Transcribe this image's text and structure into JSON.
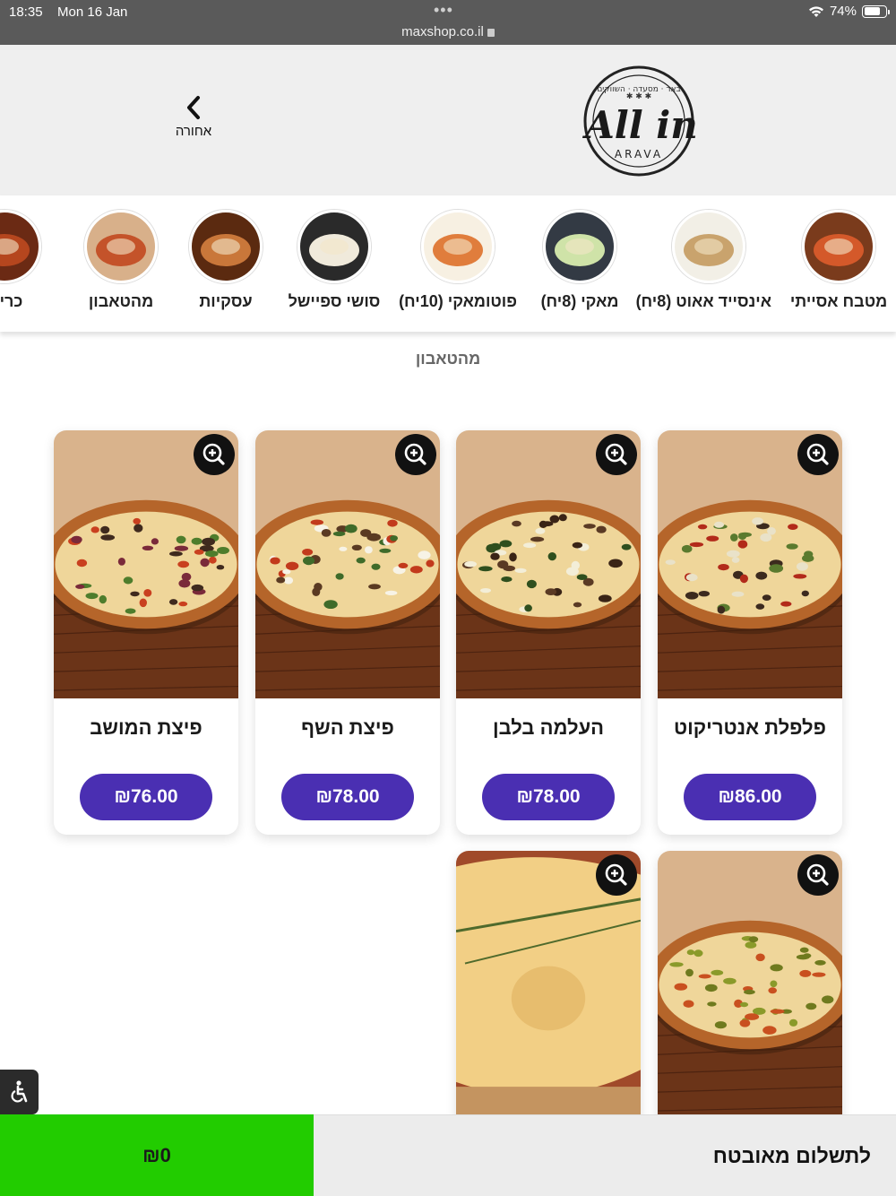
{
  "status_bar": {
    "time": "18:35",
    "date": "Mon 16 Jan",
    "url": "maxshop.co.il",
    "battery": "74%",
    "battery_level": 0.74
  },
  "header": {
    "back_label": "אחורה",
    "logo_text": "All in",
    "logo_sub": "ARAVA",
    "logo_ring": "באר · מסעדה · השווקים"
  },
  "categories": [
    {
      "label": "מטבח אסייתי",
      "icon": "asian-bowl"
    },
    {
      "label": "אינסייד אאוט (8יח)",
      "icon": "sushi-rolls"
    },
    {
      "label": "מאקי (8יח)",
      "icon": "maki-plate"
    },
    {
      "label": "פוטומאקי (10יח)",
      "icon": "futomaki-plate"
    },
    {
      "label": "סושי ספיישל",
      "icon": "sushi-special"
    },
    {
      "label": "עסקיות",
      "icon": "business-meal"
    },
    {
      "label": "מהטאבון",
      "icon": "pizza"
    },
    {
      "label": "כריכי",
      "icon": "sandwich"
    }
  ],
  "section": {
    "title": "מהטאבון"
  },
  "products": [
    {
      "name": "פלפלת אנטריקוט",
      "price": "₪86.00"
    },
    {
      "name": "העלמה בלבן",
      "price": "₪78.00"
    },
    {
      "name": "פיצת השף",
      "price": "₪78.00"
    },
    {
      "name": "פיצת המושב",
      "price": "₪76.00"
    },
    {
      "name": "",
      "price": ""
    },
    {
      "name": "",
      "price": ""
    }
  ],
  "footer": {
    "total": "₪0",
    "checkout_label": "לתשלום מאובטח"
  },
  "colors": {
    "price_button": "#4a2fb2",
    "total_bar": "#22cc00",
    "header_bg": "#efefef"
  }
}
